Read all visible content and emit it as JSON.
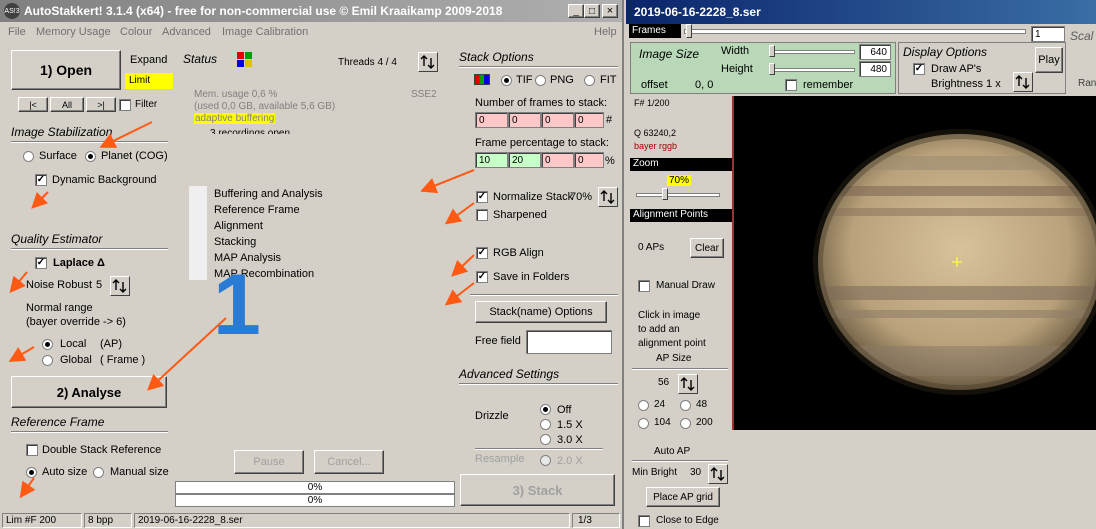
{
  "left_window": {
    "title": "AutoStakkert! 3.1.4 (x64) - free for non-commercial use © Emil Kraaikamp 2009-2018",
    "title_icon": "AS!3",
    "win_buttons": [
      "_",
      "□",
      "×"
    ],
    "menu": [
      "File",
      "Memory Usage",
      "Colour",
      "Advanced",
      "Image Calibration"
    ],
    "help": "Help",
    "open_button": "1) Open",
    "expand": "Expand",
    "limit": "Limit",
    "nav": [
      "|<",
      "All",
      ">|"
    ],
    "filter": "Filter",
    "image_stab": {
      "title": "Image Stabilization",
      "surface": "Surface",
      "planet": "Planet (COG)",
      "dynamic_bg": "Dynamic Background"
    },
    "quality": {
      "title": "Quality Estimator",
      "laplace": "Laplace Δ",
      "noise_robust": "Noise Robust",
      "noise_value": "5",
      "normal_range": "Normal range",
      "bayer_override": "(bayer override -> 6)",
      "local": "Local",
      "local_ap": "(AP)",
      "global": "Global",
      "global_frame": "( Frame )"
    },
    "analyse_button": "2) Analyse",
    "reference": {
      "title": "Reference Frame",
      "double_stack": "Double Stack Reference",
      "auto_size": "Auto size",
      "manual_size": "Manual size"
    },
    "status": {
      "title": "Status",
      "threads": "Threads 4 / 4",
      "mem": "Mem. usage 0,6 %",
      "mem_detail": "(used 0,0 GB, available 5,6 GB)",
      "sse": "SSE2",
      "adaptive": "adaptive buffering",
      "recordings": "3 recordings open",
      "steps": [
        "Buffering and Analysis",
        "Reference Frame",
        "Alignment",
        "Stacking",
        "MAP Analysis",
        "MAP Recombination"
      ],
      "pause": "Pause",
      "cancel": "Cancel...",
      "progress1": "0%",
      "progress2": "0%",
      "overlay_number": "1"
    },
    "stack": {
      "title": "Stack Options",
      "tif": "TIF",
      "png": "PNG",
      "fit": "FIT",
      "frames_label": "Number of frames to stack:",
      "frames_values": [
        "0",
        "0",
        "0",
        "0"
      ],
      "frames_unit": "#",
      "pct_label": "Frame percentage to stack:",
      "pct_values": [
        "10",
        "20",
        "0",
        "0"
      ],
      "pct_unit": "%",
      "normalize": "Normalize Stack",
      "normalize_value": "70%",
      "sharpened": "Sharpened",
      "rgb_align": "RGB Align",
      "save_folders": "Save in Folders",
      "stackname_button": "Stack(name) Options",
      "free_field": "Free field",
      "advanced_title": "Advanced Settings",
      "drizzle": "Drizzle",
      "drizzle_options": [
        "Off",
        "1.5 X",
        "3.0 X"
      ],
      "resample": "Resample",
      "resample_option": "2.0 X",
      "stack_button": "3) Stack"
    },
    "statusbar": [
      "Lim #F 200",
      "8 bpp",
      "2019-06-16-2228_8.ser",
      "1/3"
    ]
  },
  "right_window": {
    "title": "2019-06-16-2228_8.ser",
    "frames_label": "Frames",
    "frame_value": "1",
    "scale": "Scal",
    "image_size": {
      "title": "Image Size",
      "width_label": "Width",
      "height_label": "Height",
      "width": "640",
      "height": "480",
      "offset_label": "offset",
      "offset": "0, 0",
      "remember": "remember"
    },
    "display": {
      "title": "Display Options",
      "draw_aps": "Draw AP's",
      "brightness": "Brightness 1 x",
      "play": "Play",
      "ran": "Ran"
    },
    "side": {
      "frame_no": "F# 1/200",
      "q": "Q  63240,2",
      "bayer": "bayer rggb",
      "zoom": "Zoom",
      "zoom_value": "70%",
      "alignment": "Alignment Points",
      "aps": "0 APs",
      "clear": "Clear",
      "manual_draw": "Manual Draw",
      "click_info": [
        "Click in image",
        "to add an",
        "alignment point"
      ],
      "ap_size": "AP Size",
      "ap_size_value": "56",
      "sizes": [
        "24",
        "48",
        "104",
        "200"
      ],
      "auto_ap": "Auto AP",
      "min_bright": "Min Bright",
      "min_bright_value": "30",
      "place_grid": "Place AP grid",
      "close_edge": "Close to Edge"
    }
  },
  "colors": {
    "title_active": "#0a246a",
    "title_inactive": "#808080",
    "limit_bg": "#ffff00",
    "red_field": "#ffc8c8",
    "green_field": "#c8ffc8",
    "green_panel": "#b8d8b8",
    "arrow": "#ff5a14",
    "overlay_number": "#2a7bd4",
    "adaptive_bg": "#ffff00"
  }
}
